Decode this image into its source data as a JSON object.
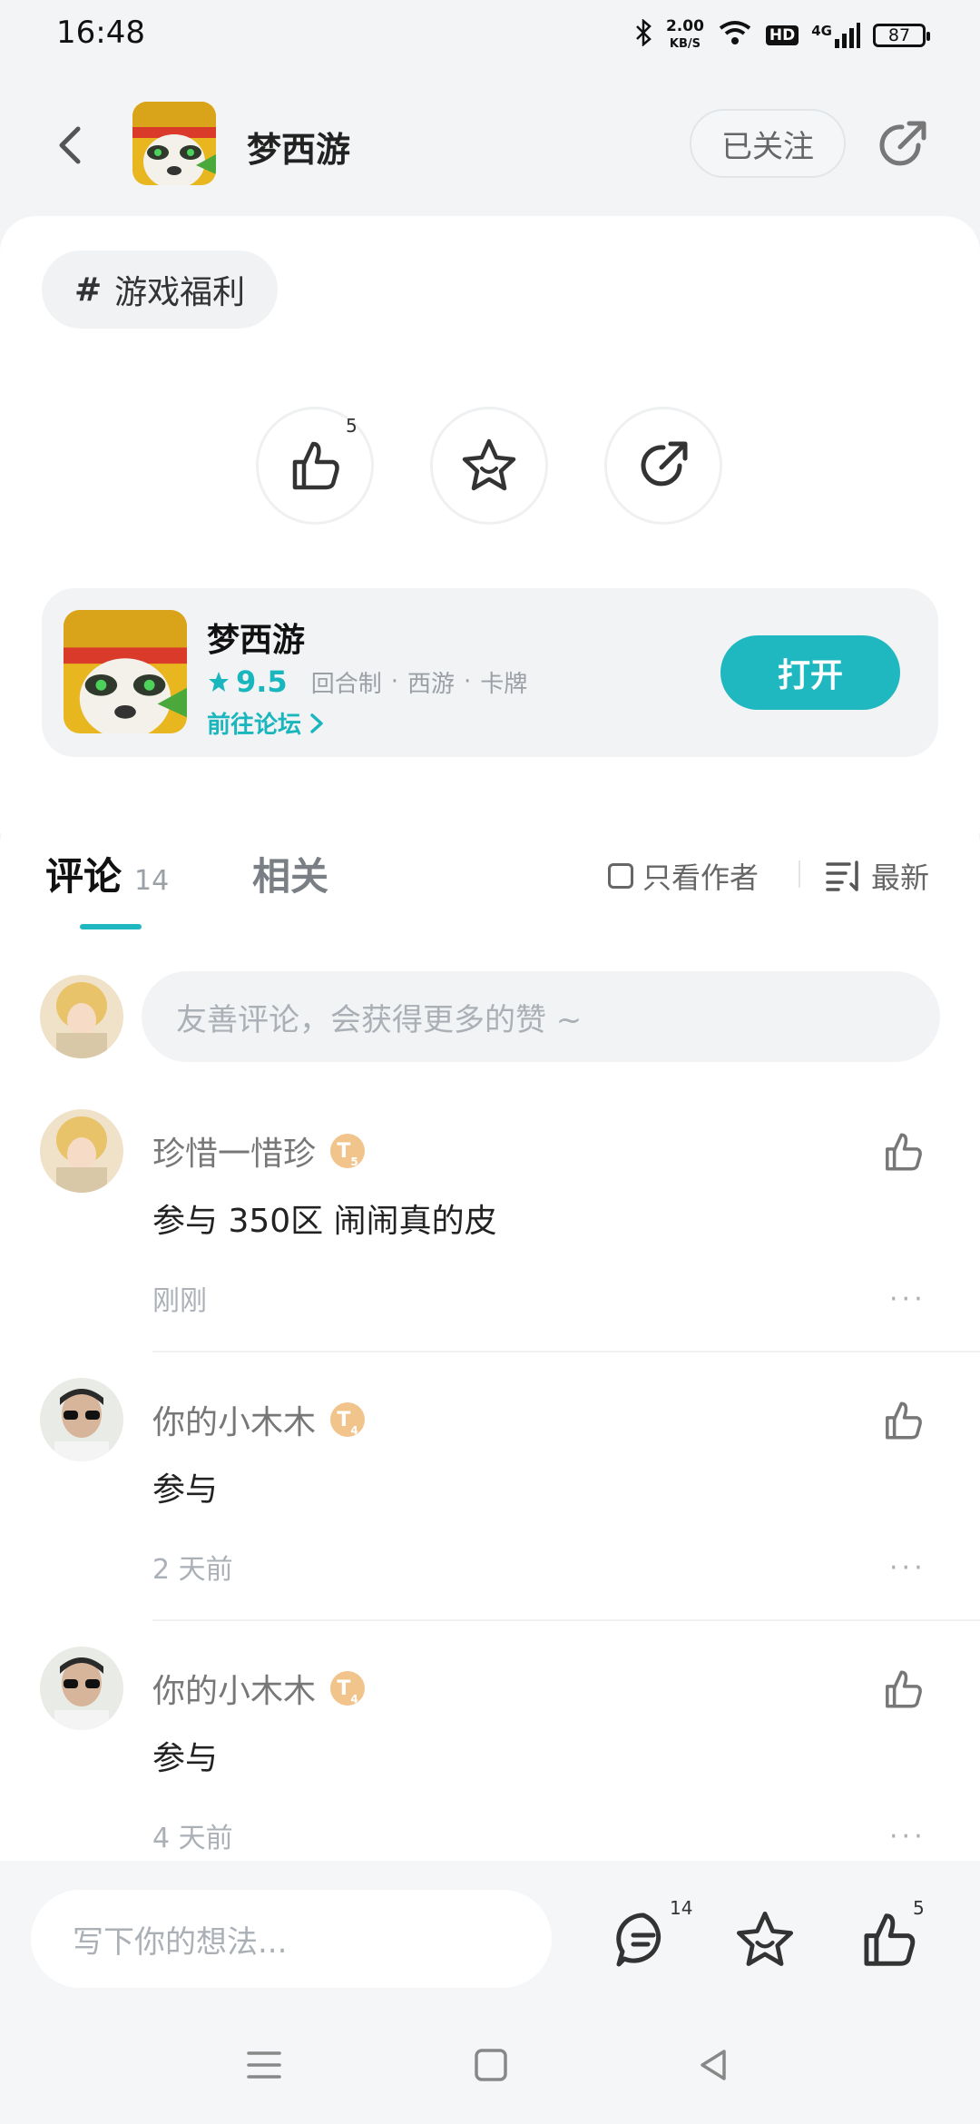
{
  "status": {
    "time": "16:48",
    "speed_value": "2.00",
    "speed_unit": "KB/S",
    "network": "4G",
    "battery": "87",
    "hd": "HD"
  },
  "header": {
    "title": "梦西游",
    "follow_label": "已关注"
  },
  "post": {
    "topic_hash": "#",
    "topic": "游戏福利",
    "like_count": "5"
  },
  "game": {
    "name": "梦西游",
    "rating": "9.5",
    "tags": [
      "回合制",
      "西游",
      "卡牌"
    ],
    "forum_label": "前往论坛",
    "open_label": "打开"
  },
  "comments_section": {
    "tab_comments": "评论",
    "tab_comments_count": "14",
    "tab_related": "相关",
    "author_only": "只看作者",
    "sort_label": "最新",
    "input_placeholder": "友善评论，会获得更多的赞 ~",
    "items": [
      {
        "user": "珍惜一惜珍",
        "level": "T",
        "level_num": "5",
        "text": "参与 350区 闹闹真的皮",
        "time": "刚刚",
        "more": "···"
      },
      {
        "user": "你的小木木",
        "level": "T",
        "level_num": "4",
        "text": "参与",
        "time": "2 天前",
        "more": "···"
      },
      {
        "user": "你的小木木",
        "level": "T",
        "level_num": "4",
        "text": "参与",
        "time": "4 天前",
        "more": "···"
      }
    ]
  },
  "bottom": {
    "placeholder": "写下你的想法...",
    "comment_count": "14",
    "like_count": "5"
  },
  "colors": {
    "accent": "#1fb8c0",
    "background": "#f2f4f6"
  }
}
